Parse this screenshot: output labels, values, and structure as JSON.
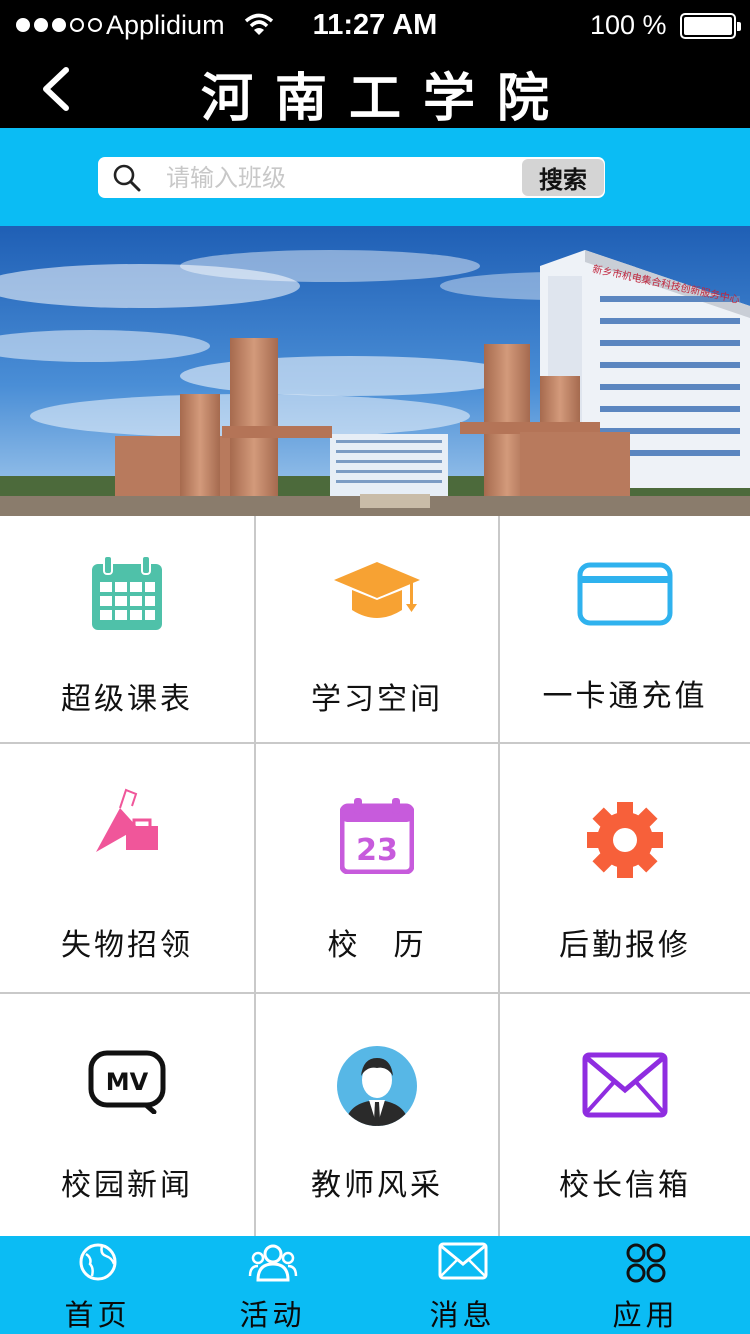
{
  "status_bar": {
    "carrier": "Applidium",
    "time": "11:27 AM",
    "battery": "100 %"
  },
  "nav": {
    "title": "河南工学院",
    "back_icon": "chevron-left-icon"
  },
  "search": {
    "placeholder": "请输入班级",
    "button_label": "搜索",
    "icon": "search-icon"
  },
  "banner": {
    "sign_text": "新乡市机电集合科技创新服务中心"
  },
  "grid": {
    "items": [
      {
        "label": "超级课表",
        "icon": "calendar-grid-icon",
        "color": "#4fc1a9"
      },
      {
        "label": "学习空间",
        "icon": "graduation-cap-icon",
        "color": "#f7a233"
      },
      {
        "label": "一卡通充值",
        "icon": "card-icon",
        "color": "#2fb2ee"
      },
      {
        "label": "失物招领",
        "icon": "umbrella-bag-icon",
        "color": "#f0569a"
      },
      {
        "label": "校　历",
        "icon": "calendar-23-icon",
        "color": "#c75bdc",
        "day": "23"
      },
      {
        "label": "后勤报修",
        "icon": "gear-icon",
        "color": "#f7603a"
      },
      {
        "label": "校园新闻",
        "icon": "mv-icon",
        "color": "#111111",
        "badge": "MV"
      },
      {
        "label": "教师风采",
        "icon": "teacher-avatar-icon",
        "color": "#57b7e6"
      },
      {
        "label": "校长信箱",
        "icon": "envelope-icon",
        "color": "#8f2de0"
      }
    ]
  },
  "tabbar": {
    "tabs": [
      {
        "label": "首页",
        "icon": "globe-icon"
      },
      {
        "label": "活动",
        "icon": "people-icon"
      },
      {
        "label": "消息",
        "icon": "envelope-icon"
      },
      {
        "label": "应用",
        "icon": "apps-icon"
      }
    ]
  },
  "colors": {
    "accent": "#0bbcf4",
    "topbar": "#000000"
  }
}
